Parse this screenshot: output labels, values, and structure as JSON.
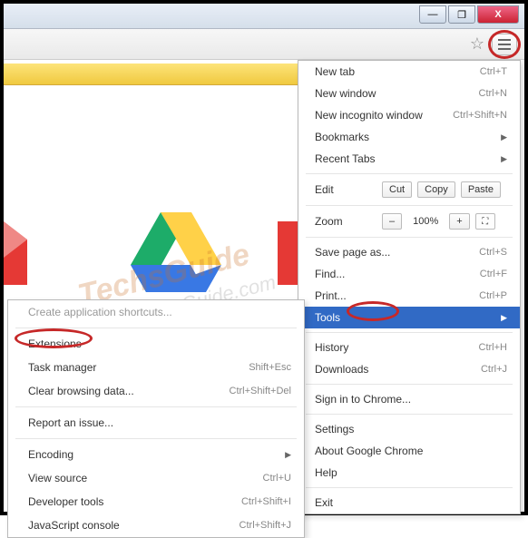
{
  "window": {
    "min": "—",
    "max": "❐",
    "close": "X"
  },
  "menu": {
    "newtab": {
      "label": "New tab",
      "shortcut": "Ctrl+T"
    },
    "newwin": {
      "label": "New window",
      "shortcut": "Ctrl+N"
    },
    "incog": {
      "label": "New incognito window",
      "shortcut": "Ctrl+Shift+N"
    },
    "bookmarks": {
      "label": "Bookmarks"
    },
    "recent": {
      "label": "Recent Tabs"
    },
    "edit": {
      "label": "Edit",
      "cut": "Cut",
      "copy": "Copy",
      "paste": "Paste"
    },
    "zoom": {
      "label": "Zoom",
      "minus": "–",
      "value": "100%",
      "plus": "+"
    },
    "save": {
      "label": "Save page as...",
      "shortcut": "Ctrl+S"
    },
    "find": {
      "label": "Find...",
      "shortcut": "Ctrl+F"
    },
    "print": {
      "label": "Print...",
      "shortcut": "Ctrl+P"
    },
    "tools": {
      "label": "Tools"
    },
    "history": {
      "label": "History",
      "shortcut": "Ctrl+H"
    },
    "downloads": {
      "label": "Downloads",
      "shortcut": "Ctrl+J"
    },
    "signin": {
      "label": "Sign in to Chrome..."
    },
    "settings": {
      "label": "Settings"
    },
    "about": {
      "label": "About Google Chrome"
    },
    "help": {
      "label": "Help"
    },
    "exit": {
      "label": "Exit"
    }
  },
  "tools_menu": {
    "create": {
      "label": "Create application shortcuts..."
    },
    "ext": {
      "label": "Extensions"
    },
    "task": {
      "label": "Task manager",
      "shortcut": "Shift+Esc"
    },
    "clear": {
      "label": "Clear browsing data...",
      "shortcut": "Ctrl+Shift+Del"
    },
    "report": {
      "label": "Report an issue..."
    },
    "encoding": {
      "label": "Encoding"
    },
    "source": {
      "label": "View source",
      "shortcut": "Ctrl+U"
    },
    "devtools": {
      "label": "Developer tools",
      "shortcut": "Ctrl+Shift+I"
    },
    "jsconsole": {
      "label": "JavaScript console",
      "shortcut": "Ctrl+Shift+J"
    }
  },
  "watermark": {
    "main": "TechsGuide",
    "sub": "www.TechsGuide.com"
  }
}
